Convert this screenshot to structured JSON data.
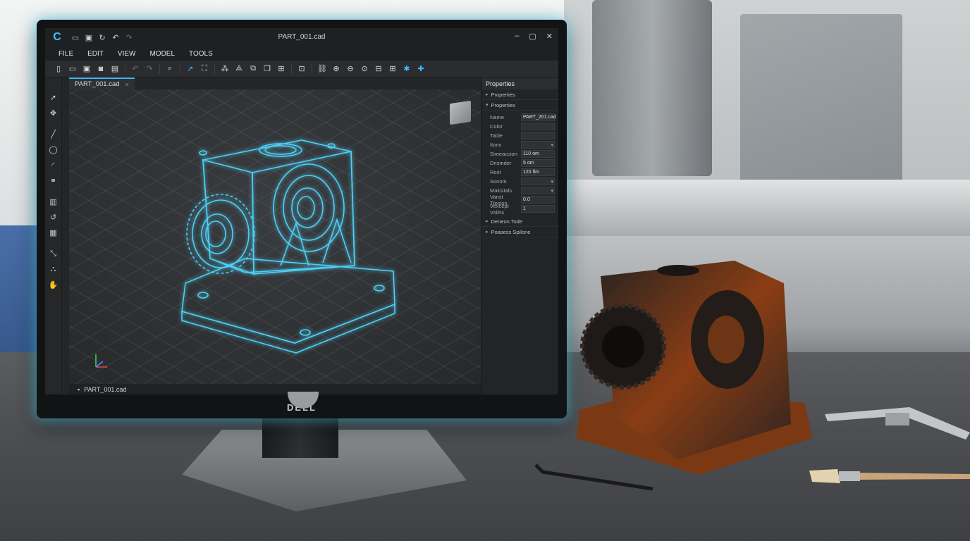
{
  "window": {
    "title": "PART_001.cad",
    "controls": {
      "minimize": "–",
      "maximize": "▢",
      "close": "✕"
    }
  },
  "menu": [
    "FILE",
    "EDIT",
    "VIEW",
    "MODEL",
    "TOOLS"
  ],
  "document_tab": {
    "label": "PART_001.cad",
    "close": "×"
  },
  "bottom_tab": {
    "label": "PART_001.cad"
  },
  "monitor_brand": "DELL",
  "properties_panel": {
    "header": "Properties",
    "sections": [
      {
        "label": "Properties",
        "expanded": false
      },
      {
        "label": "Properties",
        "expanded": true
      }
    ],
    "rows": [
      {
        "key": "Name",
        "value": "PART_201.cad",
        "dropdown": false
      },
      {
        "key": "Color",
        "value": "",
        "dropdown": false
      },
      {
        "key": "Table",
        "value": "",
        "dropdown": false
      },
      {
        "key": "Itons",
        "value": "",
        "dropdown": true
      },
      {
        "key": "Simeaccion",
        "value": "110 om",
        "dropdown": false
      },
      {
        "key": "Drismder",
        "value": "5 om",
        "dropdown": false
      },
      {
        "key": "Rost",
        "value": "120 fim",
        "dropdown": false
      },
      {
        "key": "Sonom",
        "value": "",
        "dropdown": true
      },
      {
        "key": "Maksitals",
        "value": "",
        "dropdown": true
      },
      {
        "key": "Vanst Ttesion",
        "value": "0.0",
        "dropdown": false
      },
      {
        "key": "Vexcept Vsilns",
        "value": "1",
        "dropdown": false
      }
    ],
    "collapsed_sections": [
      "Deneon Tode",
      "Poasess Spilone"
    ]
  },
  "icons": {
    "quick_access": [
      "folder-open-icon",
      "save-icon",
      "history-icon",
      "undo-icon",
      "redo-icon"
    ],
    "toolbar": [
      "new-file-icon",
      "open-folder-icon",
      "save-icon",
      "save-as-icon",
      "print-icon",
      "undo-icon",
      "redo-icon",
      "zoom-icon",
      "select-arrow-icon",
      "fit-icon",
      "nodes-icon",
      "vertex-icon",
      "copy-icon",
      "duplicate-icon",
      "group-icon",
      "frame-icon",
      "link-icon",
      "zoom-in-icon",
      "zoom-out-icon",
      "zoom-window-icon",
      "view-icon",
      "grid-icon",
      "render-icon",
      "pin-icon"
    ],
    "left_tools": [
      "select-icon",
      "move-icon",
      "line-icon",
      "ellipse-icon",
      "arc-icon",
      "circles-icon",
      "extrude-icon",
      "revolve-icon",
      "pattern-icon",
      "dimension-icon",
      "assembly-icon",
      "hand-icon"
    ]
  },
  "colors": {
    "accent": "#3fb7ff",
    "glow": "#50dcff",
    "wireframe": "#4fd8ff"
  }
}
